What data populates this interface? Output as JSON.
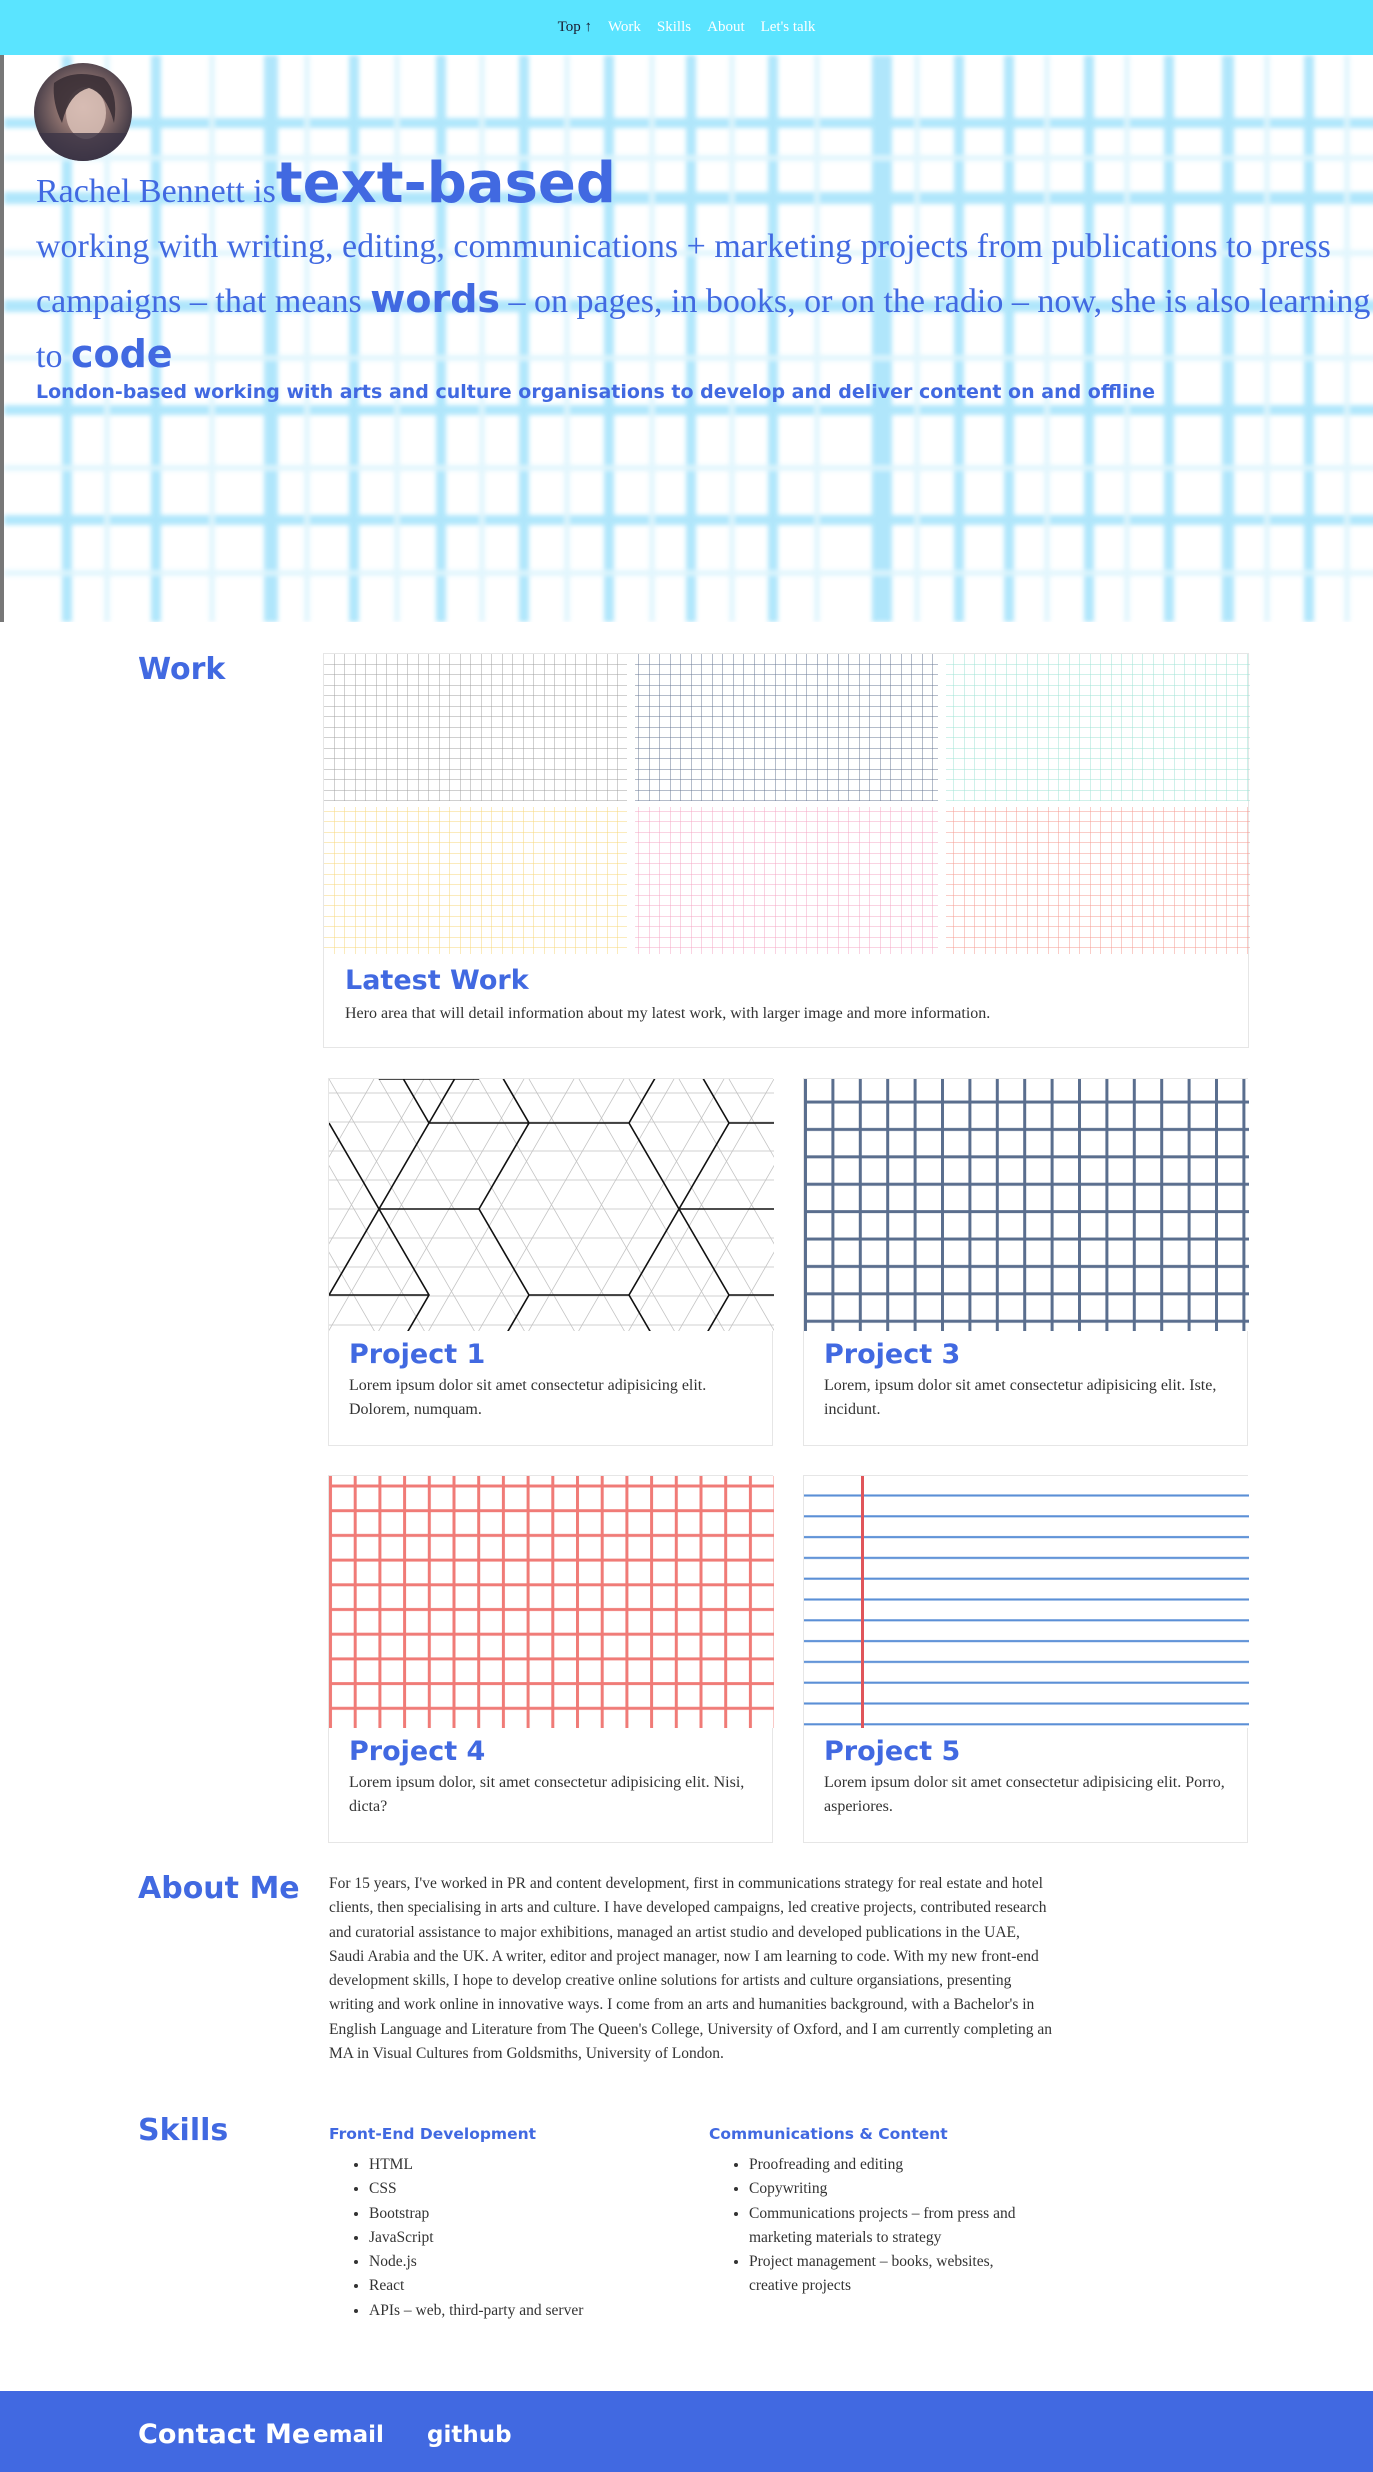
{
  "nav": {
    "top_label": "Top ↑",
    "items": [
      "Work",
      "Skills",
      "About",
      "Let's talk"
    ]
  },
  "hero": {
    "name_prefix": "Rachel Bennett is",
    "highlight": "text-based",
    "sentence_start": "working with writing, editing, communications + marketing projects from publications to press campaigns – that means",
    "words": "words",
    "sentence_mid": "– on pages, in books, or on the radio – now, she is also learning to",
    "code": "code",
    "subtitle": "London-based working with arts and culture organisations to develop and deliver content on and offline"
  },
  "work": {
    "title": "Work",
    "latest": {
      "title": "Latest Work",
      "text": "Hero area that will detail information about my latest work, with larger image and more information."
    },
    "projects": [
      {
        "title": "Project 1",
        "text": "Lorem ipsum dolor sit amet consectetur adipisicing elit. Dolorem, numquam."
      },
      {
        "title": "Project 3",
        "text": "Lorem, ipsum dolor sit amet consectetur adipisicing elit. Iste, incidunt."
      },
      {
        "title": "Project 4",
        "text": "Lorem ipsum dolor, sit amet consectetur adipisicing elit. Nisi, dicta?"
      },
      {
        "title": "Project 5",
        "text": "Lorem ipsum dolor sit amet consectetur adipisicing elit. Porro, asperiores."
      }
    ]
  },
  "about": {
    "title": "About Me",
    "text": "For 15 years, I've worked in PR and content development, first in communications strategy for real estate and hotel clients, then specialising in arts and culture. I have developed campaigns, led creative projects, contributed research and curatorial assistance to major exhibitions, managed an artist studio and developed publications in the UAE, Saudi Arabia and the UK. A writer, editor and project manager, now I am learning to code. With my new front-end development skills, I hope to develop creative online solutions for artists and culture organsiations, presenting writing and work online in innovative ways. I come from an arts and humanities background, with a Bachelor's in English Language and Literature from The Queen's College, University of Oxford, and I am currently completing an MA in Visual Cultures from Goldsmiths, University of London."
  },
  "skills": {
    "title": "Skills",
    "frontend": {
      "heading": "Front-End Development",
      "items": [
        "HTML",
        "CSS",
        "Bootstrap",
        "JavaScript",
        "Node.js",
        "React",
        "APIs – web, third-party and server"
      ]
    },
    "comms": {
      "heading": "Communications & Content",
      "items": [
        "Proofreading and editing",
        "Copywriting",
        "Communications projects – from press and marketing materials to strategy",
        "Project management – books, websites, creative projects"
      ]
    }
  },
  "footer": {
    "title": "Contact Me",
    "email": "email",
    "github": "github"
  },
  "colors": {
    "accent": "#4169e1",
    "nav_bg": "#5ae4ff",
    "grid_blue": "#a8e4fb"
  }
}
